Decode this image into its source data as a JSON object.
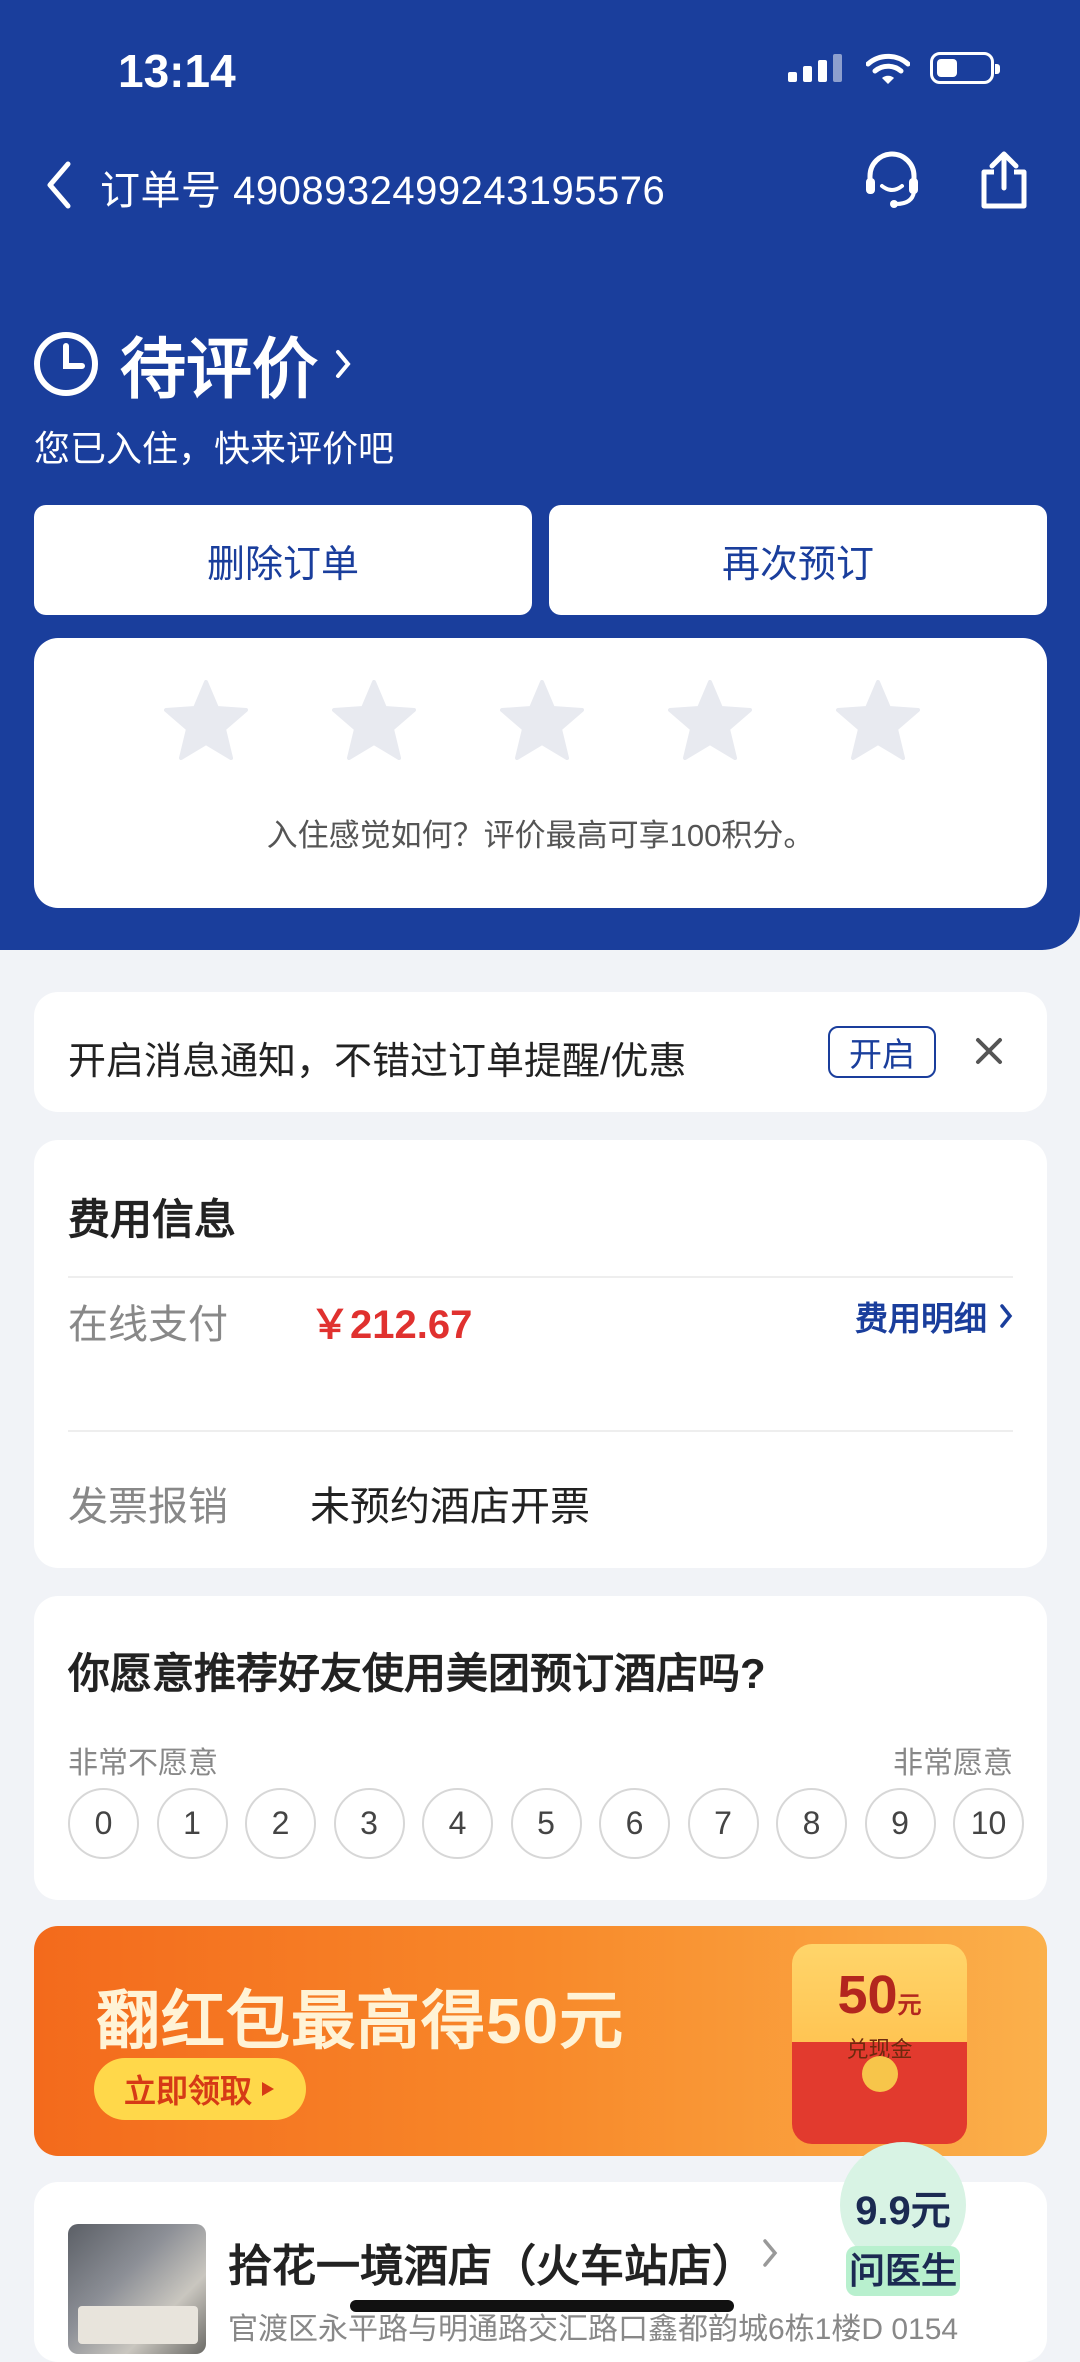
{
  "status_bar": {
    "time": "13:14"
  },
  "nav": {
    "order_label": "订单号 4908932499243195576"
  },
  "order_status": {
    "title": "待评价",
    "subtitle": "您已入住，快来评价吧"
  },
  "actions": {
    "delete": "删除订单",
    "rebook": "再次预订"
  },
  "rating": {
    "stars": 5,
    "prompt": "入住感觉如何？评价最高可享100积分。"
  },
  "notification": {
    "text": "开启消息通知，不错过订单提醒/优惠",
    "enable": "开启"
  },
  "fee": {
    "title": "费用信息",
    "payment_label": "在线支付",
    "payment_value": "￥212.67",
    "detail_link": "费用明细",
    "invoice_label": "发票报销",
    "invoice_value": "未预约酒店开票"
  },
  "nps": {
    "question": "你愿意推荐好友使用美团预订酒店吗?",
    "low_label": "非常不愿意",
    "high_label": "非常愿意",
    "scale": [
      "0",
      "1",
      "2",
      "3",
      "4",
      "5",
      "6",
      "7",
      "8",
      "9",
      "10"
    ]
  },
  "banner": {
    "headline": "翻红包最高得50元",
    "cta": "立即领取",
    "amount": "50",
    "unit": "元",
    "cash": "兑现金"
  },
  "hotel": {
    "name": "拾花一境酒店（火车站店）",
    "address": "官渡区永平路与明通路交汇路口鑫都韵城6栋1楼D 0154"
  },
  "float_ad": {
    "price": "9.9元",
    "label": "问医生"
  },
  "colors": {
    "primary": "#1a3e9c",
    "price": "#e0312f",
    "banner": "#f8892a"
  }
}
